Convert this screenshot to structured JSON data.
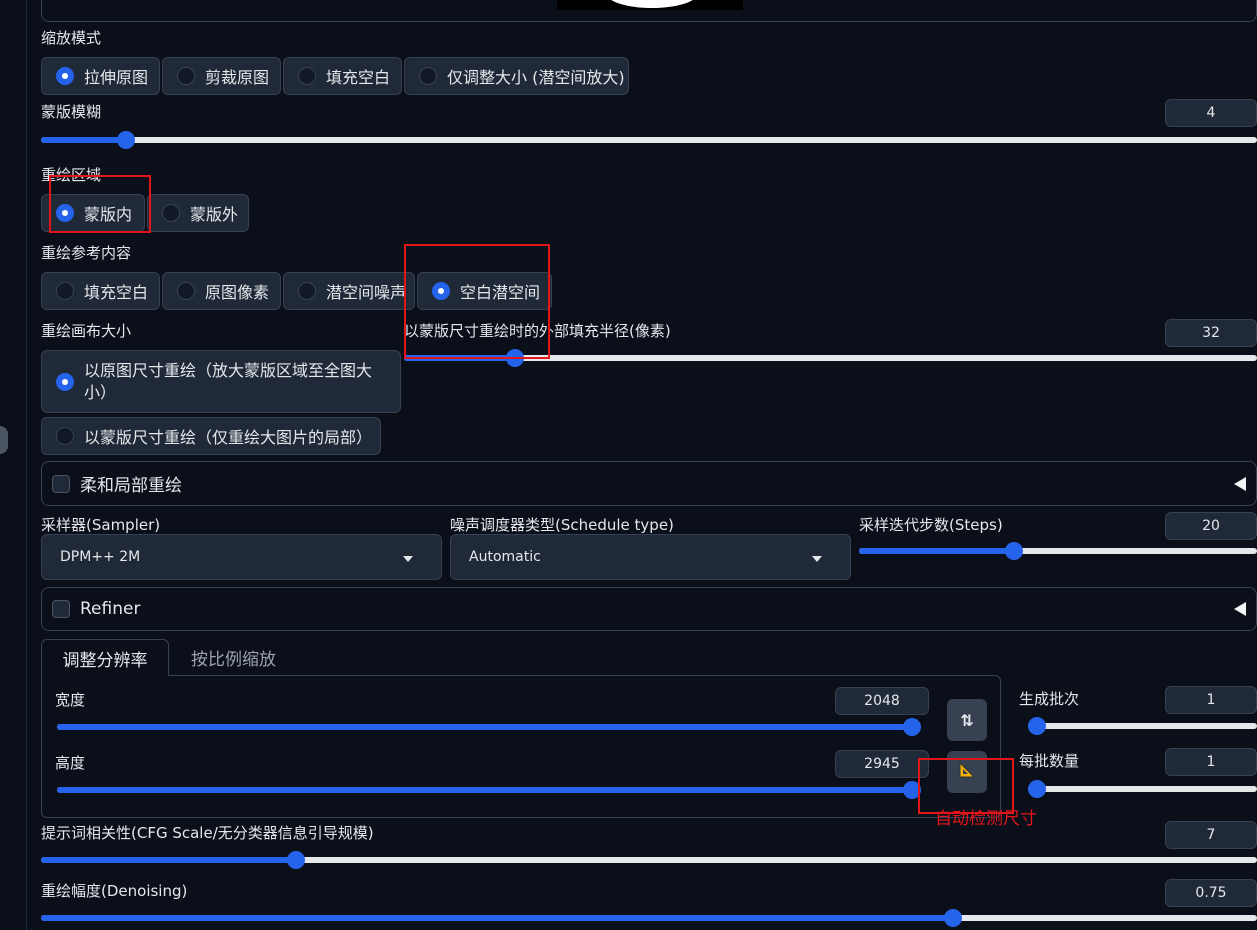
{
  "resize_mode": {
    "label": "缩放模式",
    "options": [
      "拉伸原图",
      "剪裁原图",
      "填充空白",
      "仅调整大小 (潜空间放大)"
    ],
    "selected": 0
  },
  "mask_blur": {
    "label": "蒙版模糊",
    "value": "4",
    "level": 0.07
  },
  "inpaint_area": {
    "label": "重绘区域",
    "options": [
      "蒙版内",
      "蒙版外"
    ],
    "selected": 0
  },
  "masked_content": {
    "label": "重绘参考内容",
    "options": [
      "填充空白",
      "原图像素",
      "潜空间噪声",
      "空白潜空间"
    ],
    "selected": 3
  },
  "inpaint_canvas": {
    "label": "重绘画布大小",
    "options": [
      "以原图尺寸重绘（放大蒙版区域至全图大小）",
      "以蒙版尺寸重绘（仅重绘大图片的局部）"
    ],
    "selected": 0
  },
  "only_masked_padding": {
    "label": "以蒙版尺寸重绘时的外部填充半径(像素)",
    "value": "32",
    "level": 0.13
  },
  "soft_inpainting": {
    "label": "柔和局部重绘"
  },
  "sampler": {
    "label": "采样器(Sampler)",
    "value": "DPM++ 2M"
  },
  "schedule_type": {
    "label": "噪声调度器类型(Schedule type)",
    "value": "Automatic"
  },
  "steps": {
    "label": "采样迭代步数(Steps)",
    "value": "20",
    "level": 0.39
  },
  "refiner": {
    "label": "Refiner"
  },
  "size_tabs": [
    "调整分辨率",
    "按比例缩放"
  ],
  "width": {
    "label": "宽度",
    "value": "2048",
    "level": 1.0
  },
  "height": {
    "label": "高度",
    "value": "2945",
    "level": 1.0
  },
  "swap_icon": "⇅",
  "auto_detect_icon": "📐",
  "batch_count": {
    "label": "生成批次",
    "value": "1",
    "level": 0.0
  },
  "batch_size": {
    "label": "每批数量",
    "value": "1",
    "level": 0.0
  },
  "cfg": {
    "label": "提示词相关性(CFG Scale/无分类器信息引导规模)",
    "value": "7",
    "level": 0.21
  },
  "denoising": {
    "label": "重绘幅度(Denoising)",
    "value": "0.75",
    "level": 0.75
  },
  "annotation": {
    "auto_detect": "自动检测尺寸"
  },
  "colors": {
    "accent": "#2563eb",
    "annotation": "#e0161b",
    "background": "#0b0f19"
  }
}
